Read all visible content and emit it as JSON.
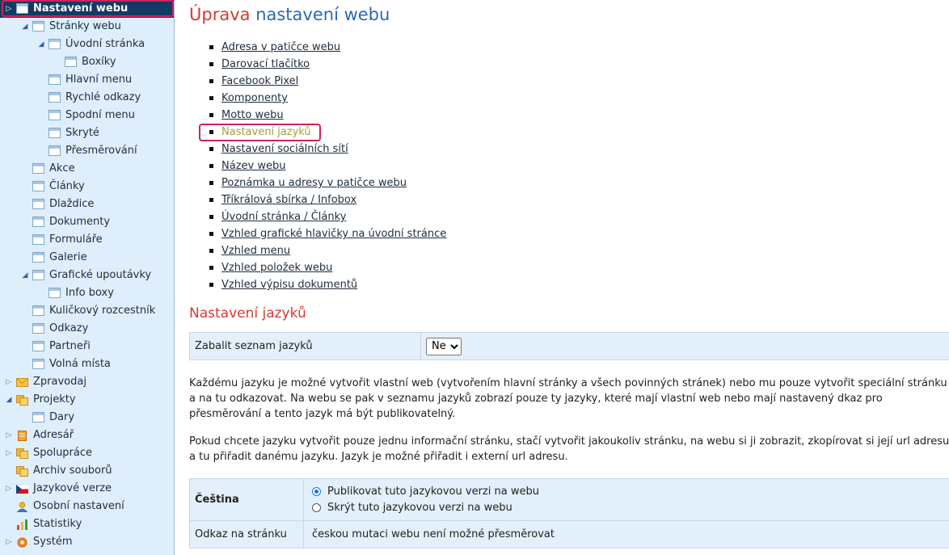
{
  "sidebar": {
    "items": [
      {
        "label": "Nastavení webu",
        "level": 0,
        "arrow": "closed",
        "icon": "page-icon",
        "selected": true
      },
      {
        "label": "Stránky webu",
        "level": 1,
        "arrow": "open",
        "icon": "page-icon"
      },
      {
        "label": "Úvodní stránka",
        "level": 2,
        "arrow": "open",
        "icon": "page-icon"
      },
      {
        "label": "Boxíky",
        "level": 3,
        "arrow": "",
        "icon": "page-icon"
      },
      {
        "label": "Hlavní menu",
        "level": 2,
        "arrow": "",
        "icon": "page-icon"
      },
      {
        "label": "Rychlé odkazy",
        "level": 2,
        "arrow": "",
        "icon": "page-icon"
      },
      {
        "label": "Spodní menu",
        "level": 2,
        "arrow": "",
        "icon": "page-icon"
      },
      {
        "label": "Skryté",
        "level": 2,
        "arrow": "",
        "icon": "page-icon"
      },
      {
        "label": "Přesměrování",
        "level": 2,
        "arrow": "",
        "icon": "page-icon"
      },
      {
        "label": "Akce",
        "level": 1,
        "arrow": "",
        "icon": "page-icon"
      },
      {
        "label": "Články",
        "level": 1,
        "arrow": "",
        "icon": "page-icon"
      },
      {
        "label": "Dlaždice",
        "level": 1,
        "arrow": "",
        "icon": "page-icon"
      },
      {
        "label": "Dokumenty",
        "level": 1,
        "arrow": "",
        "icon": "page-icon"
      },
      {
        "label": "Formuláře",
        "level": 1,
        "arrow": "",
        "icon": "page-icon"
      },
      {
        "label": "Galerie",
        "level": 1,
        "arrow": "",
        "icon": "page-icon"
      },
      {
        "label": "Grafické upoutávky",
        "level": 1,
        "arrow": "open",
        "icon": "page-icon"
      },
      {
        "label": "Info boxy",
        "level": 2,
        "arrow": "",
        "icon": "page-icon"
      },
      {
        "label": "Kuličkový rozcestník",
        "level": 1,
        "arrow": "",
        "icon": "page-icon"
      },
      {
        "label": "Odkazy",
        "level": 1,
        "arrow": "",
        "icon": "page-icon"
      },
      {
        "label": "Partneři",
        "level": 1,
        "arrow": "",
        "icon": "page-icon"
      },
      {
        "label": "Volná místa",
        "level": 1,
        "arrow": "",
        "icon": "page-icon"
      },
      {
        "label": "Zpravodaj",
        "level": 0,
        "arrow": "closed",
        "icon": "envelope-icon"
      },
      {
        "label": "Projekty",
        "level": 0,
        "arrow": "open",
        "icon": "folders-icon"
      },
      {
        "label": "Dary",
        "level": 1,
        "arrow": "",
        "icon": "page-icon"
      },
      {
        "label": "Adresář",
        "level": 0,
        "arrow": "closed",
        "icon": "address-book-icon"
      },
      {
        "label": "Spolupráce",
        "level": 0,
        "arrow": "closed",
        "icon": "folders-icon"
      },
      {
        "label": "Archiv souborů",
        "level": 0,
        "arrow": "",
        "icon": "folders-icon"
      },
      {
        "label": "Jazykové verze",
        "level": 0,
        "arrow": "closed",
        "icon": "czech-flag-icon"
      },
      {
        "label": "Osobní nastavení",
        "level": 0,
        "arrow": "",
        "icon": "user-icon"
      },
      {
        "label": "Statistiky",
        "level": 0,
        "arrow": "",
        "icon": "bar-chart-icon"
      },
      {
        "label": "Systém",
        "level": 0,
        "arrow": "closed",
        "icon": "gear-icon"
      }
    ]
  },
  "main": {
    "title_accent": "Úprava",
    "title_rest": "nastavení webu",
    "links": [
      "Adresa v patičce webu",
      "Darovací tlačítko",
      "Facebook Pixel",
      "Komponenty",
      "Motto webu",
      "Nastavení jazyků",
      "Nastavení sociálních sítí",
      "Název webu",
      "Poznámka u adresy v patičce webu",
      "Tříkrálová sbírka / Infobox",
      "Úvodní stránka / Články",
      "Vzhled grafické hlavičky na úvodní stránce",
      "Vzhled menu",
      "Vzhled položek webu",
      "Vzhled výpisu dokumentů"
    ],
    "active_link_index": 5,
    "section_title": "Nastavení jazyků",
    "wrap_label": "Zabalit seznam jazyků",
    "wrap_value": "Ne",
    "wrap_options": [
      "Ne"
    ],
    "para1": "Každému jazyku je možné vytvořit vlastní web (vytvořením hlavní stránky a všech povinných stránek) nebo mu pouze vytvořit speciální stránku a na tu odkazovat. Na webu se pak v seznamu jazyků zobrazí pouze ty jazyky, které mají vlastní web nebo mají nastavený dkaz pro přesměrování a tento jazyk má být publikovatelný.",
    "para2": "Pokud chcete jazyku vytvořit pouze jednu informační stránku, stačí vytvořit jakoukoliv stránku, na webu si ji zobrazit, zkopírovat si její url adresu a tu přiřadit danému jazyku. Jazyk je možné přiřadit i externí url adresu.",
    "language_name": "Čeština",
    "radio_publish": "Publikovat tuto jazykovou verzi na webu",
    "radio_hide": "Skrýt tuto jazykovou verzi na webu",
    "radio_selected": "publish",
    "link_label": "Odkaz na stránku",
    "link_value": "českou mutaci webu není možné přesměrovat"
  }
}
